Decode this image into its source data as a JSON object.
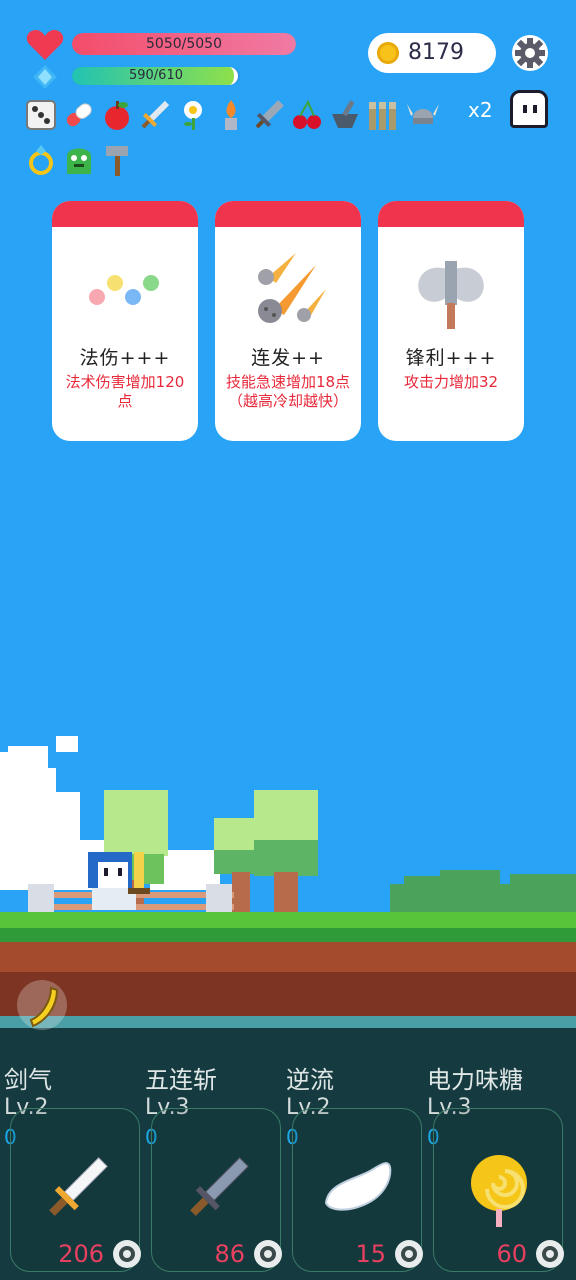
{
  "hud": {
    "hp_text": "5050/5050",
    "hp_fraction": 1.0,
    "mp_text": "590/610",
    "mp_fraction": 0.967,
    "coins": "8179",
    "multiplier": "x2"
  },
  "inventory": {
    "items": [
      "dice-icon",
      "pill-icon",
      "apple-icon",
      "sword-icon",
      "flower-icon",
      "candle-icon",
      "blade-icon",
      "cherry-icon",
      "mortar-icon",
      "bullets-icon",
      "viking-helmet-icon",
      "ring-icon",
      "slime-icon",
      "hammer-icon"
    ]
  },
  "choices": [
    {
      "name": "法伤+++",
      "desc": "法术伤害增加120点"
    },
    {
      "name": "连发++",
      "desc": "技能急速增加18点（越高冷却越快）"
    },
    {
      "name": "锋利+++",
      "desc": "攻击力增加32"
    }
  ],
  "skills": [
    {
      "name": "剑气",
      "level": "Lv.2",
      "count": "0",
      "cost": "206"
    },
    {
      "name": "五连斩",
      "level": "Lv.3",
      "count": "0",
      "cost": "86"
    },
    {
      "name": "逆流",
      "level": "Lv.2",
      "count": "0",
      "cost": "15"
    },
    {
      "name": "电力味糖",
      "level": "Lv.3",
      "count": "0",
      "cost": "60"
    }
  ],
  "colors": {
    "sky": "#29a3f5",
    "card_header": "#f1344e",
    "card_desc": "#e8293a",
    "cost": "#e84060",
    "count": "#1ba9e8"
  }
}
